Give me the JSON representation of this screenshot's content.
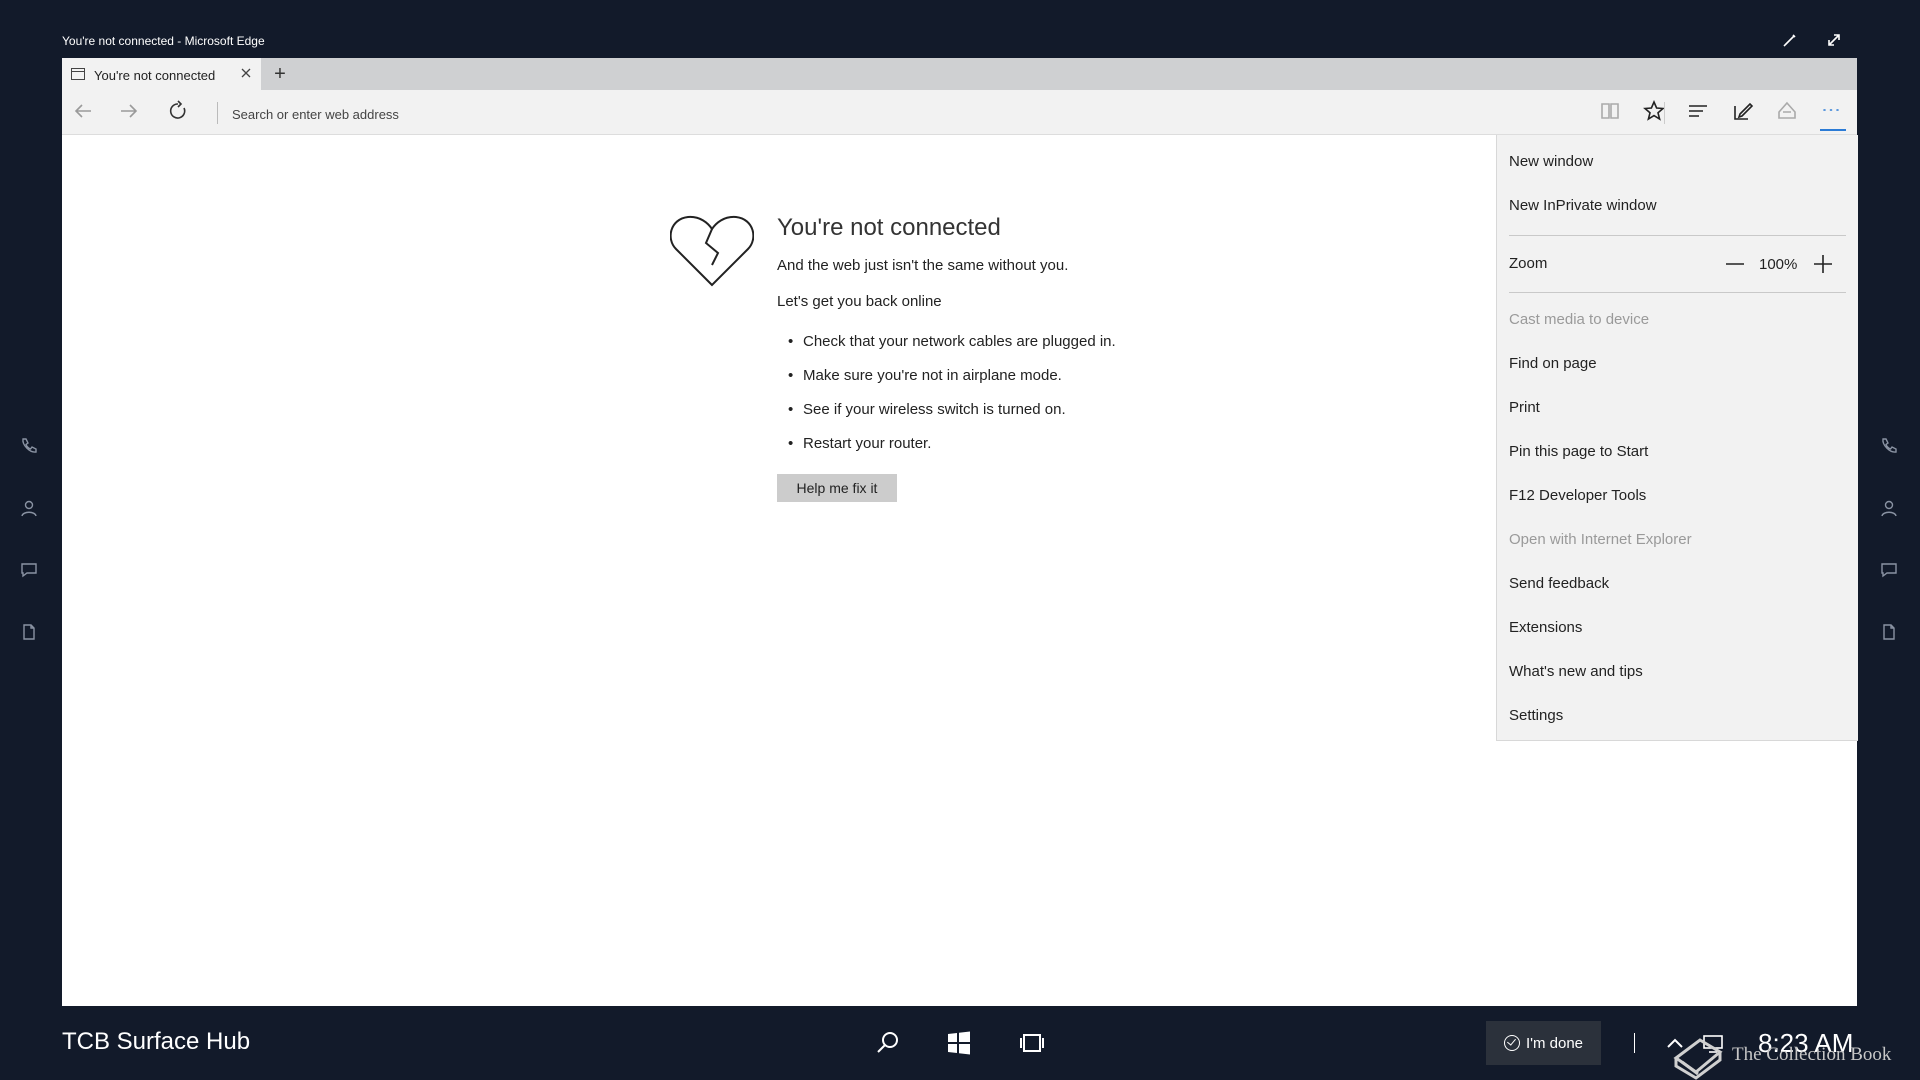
{
  "window": {
    "title": "You're not connected - Microsoft Edge"
  },
  "tab": {
    "title": "You're not connected",
    "new_tab": "+"
  },
  "address": {
    "placeholder": "Search or enter web address"
  },
  "error": {
    "title": "You're not connected",
    "subtitle": "And the web just isn't the same without you.",
    "subtitle2": "Let's get you back online",
    "tips": [
      "Check that your network cables are plugged in.",
      "Make sure you're not in airplane mode.",
      "See if your wireless switch is turned on.",
      "Restart your router."
    ],
    "fix_button": "Help me fix it"
  },
  "menu": {
    "new_window": "New window",
    "new_inprivate": "New InPrivate window",
    "zoom_label": "Zoom",
    "zoom_value": "100%",
    "cast": "Cast media to device",
    "find": "Find on page",
    "print": "Print",
    "pin": "Pin this page to Start",
    "devtools": "F12 Developer Tools",
    "open_ie": "Open with Internet Explorer",
    "feedback": "Send feedback",
    "extensions": "Extensions",
    "whats_new": "What's new and tips",
    "settings": "Settings"
  },
  "taskbar": {
    "device_name": "TCB Surface Hub",
    "done_label": "I'm done",
    "clock": "8:23 AM"
  },
  "watermark": {
    "text": "The Collection Book"
  },
  "colors": {
    "background": "#121a2a",
    "accent": "#2b7bd6",
    "menu_bg": "#f2f2f2"
  }
}
